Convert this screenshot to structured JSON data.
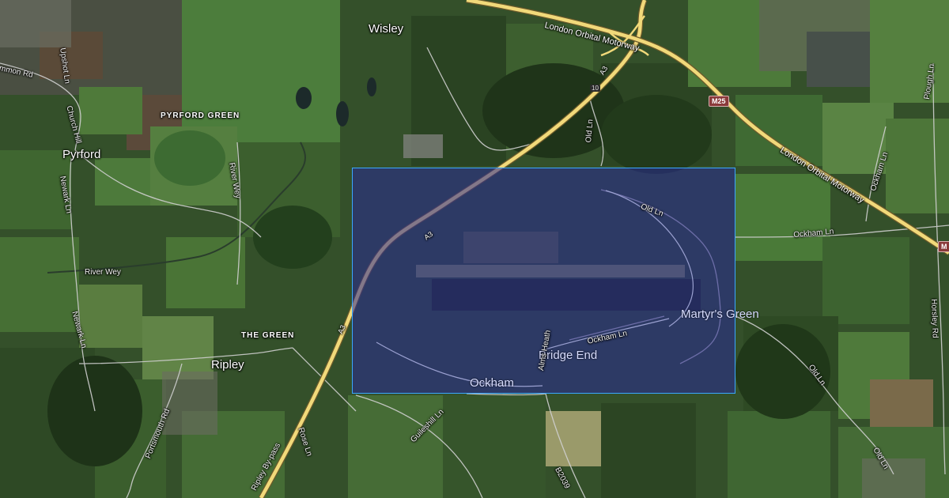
{
  "map": {
    "type": "satellite",
    "colors": {
      "field_dark": "#2f4a26",
      "field_light": "#4f7a3a",
      "woodland": "#1e3318",
      "road_major": "#f1d97a",
      "road_minor": "#cfcfcf",
      "highlight_fill": "#28289a",
      "highlight_border": "#3aa8ff"
    },
    "places": {
      "wisley": "Wisley",
      "pyrford": "Pyrford",
      "pyrford_green": "PYRFORD GREEN",
      "ripley": "Ripley",
      "the_green": "THE GREEN",
      "martyrs_green": "Martyr's Green",
      "bridge_end": "Bridge End",
      "ockham": "Ockham"
    },
    "roads": {
      "london_orbital_1": "London Orbital Motorway",
      "london_orbital_2": "London Orbital Motorway",
      "m25": "M25",
      "m25_edge": "M",
      "a3_north": "A3",
      "a3_mid": "A3",
      "a3_south": "A3",
      "jn10": "10",
      "old_ln_north": "Old Ln",
      "old_ln_mid": "Old Ln",
      "old_ln_east": "Old Ln",
      "old_ln_se": "Old Ln",
      "ockham_ln_east": "Ockham Ln",
      "ockham_ln_mid": "Ockham Ln",
      "plough_ln": "Plough Ln",
      "hatchford_ln": "Ockham Ln",
      "horsley_rd": "Horsley Rd",
      "river_wey_west": "River Wey",
      "river_wey_north": "River Wey",
      "upshot_ln": "Upshot Ln",
      "church_hill": "Church Hill",
      "newark_ln_1": "Newark Ln",
      "newark_ln_2": "Newark Ln",
      "portsmouth_rd": "Portsmouth Rd",
      "ripley_bypass": "Ripley By-pass",
      "rose_ln": "Rose Ln",
      "guileshill_ln": "Guileshill Ln",
      "alms_heath": "Alms Heath",
      "b2039": "B2039",
      "common_rd": "mmon Rd"
    },
    "selection": {
      "visible": true
    }
  }
}
